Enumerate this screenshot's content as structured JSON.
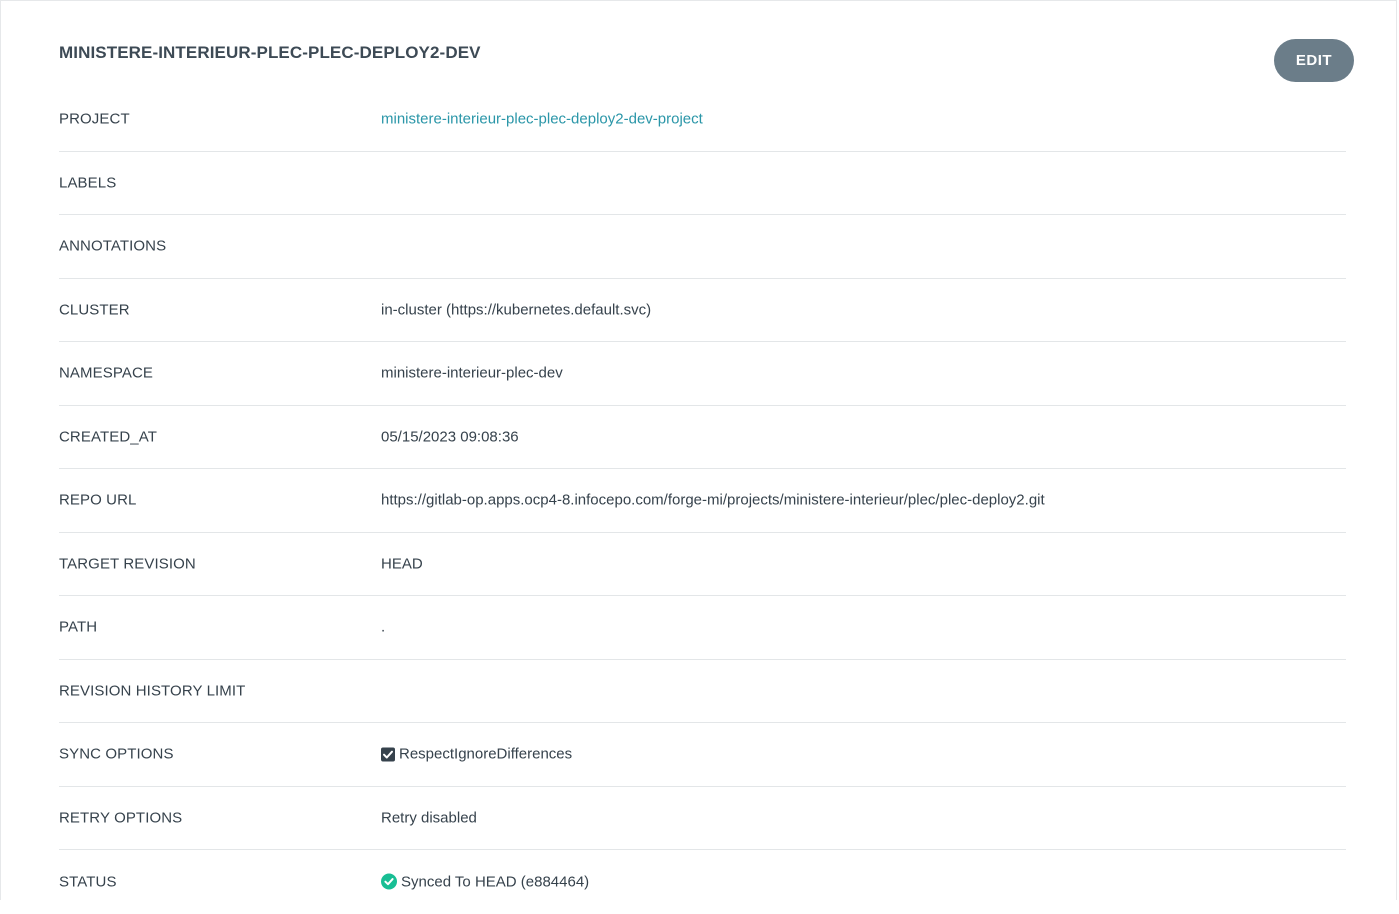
{
  "app": {
    "title": "MINISTERE-INTERIEUR-PLEC-PLEC-DEPLOY2-DEV",
    "edit_label": "EDIT"
  },
  "fields": {
    "project": {
      "label": "PROJECT",
      "value": "ministere-interieur-plec-plec-deploy2-dev-project"
    },
    "labels": {
      "label": "LABELS",
      "value": ""
    },
    "annotations": {
      "label": "ANNOTATIONS",
      "value": ""
    },
    "cluster": {
      "label": "CLUSTER",
      "value": "in-cluster (https://kubernetes.default.svc)"
    },
    "namespace": {
      "label": "NAMESPACE",
      "value": "ministere-interieur-plec-dev"
    },
    "created_at": {
      "label": "CREATED_AT",
      "value": "05/15/2023 09:08:36"
    },
    "repo_url": {
      "label": "REPO URL",
      "value": "https://gitlab-op.apps.ocp4-8.infocepo.com/forge-mi/projects/ministere-interieur/plec/plec-deploy2.git"
    },
    "target_revision": {
      "label": "TARGET REVISION",
      "value": "HEAD"
    },
    "path": {
      "label": "PATH",
      "value": "."
    },
    "revision_history_limit": {
      "label": "REVISION HISTORY LIMIT",
      "value": ""
    },
    "sync_options": {
      "label": "SYNC OPTIONS",
      "value": "RespectIgnoreDifferences",
      "checked": true
    },
    "retry_options": {
      "label": "RETRY OPTIONS",
      "value": "Retry disabled"
    },
    "status": {
      "label": "STATUS",
      "value": "Synced To HEAD (e884464)",
      "icon": "check-circle-icon"
    }
  },
  "colors": {
    "link": "#2a96a8",
    "button": "#6b7d89",
    "status_ok": "#18be94",
    "checkbox": "#36424c"
  }
}
